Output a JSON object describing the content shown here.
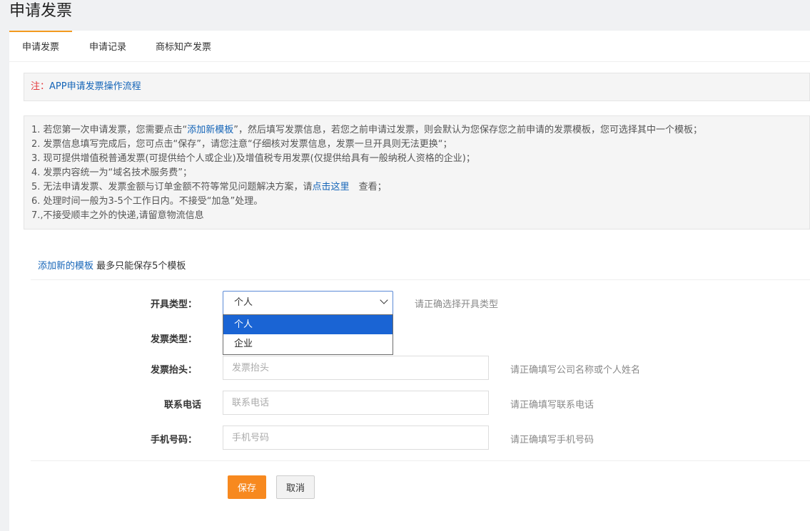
{
  "page": {
    "title": "申请发票"
  },
  "tabs": [
    {
      "label": "申请发票",
      "active": true
    },
    {
      "label": "申请记录",
      "active": false
    },
    {
      "label": "商标知产发票",
      "active": false
    }
  ],
  "note": {
    "prefix": "注：",
    "link_text": "APP申请发票操作流程"
  },
  "info": {
    "line1_pre": "1. 若您第一次申请发票，您需要点击“",
    "line1_link": "添加新模板",
    "line1_post": "”，然后填写发票信息，若您之前申请过发票，则会默认为您保存您之前申请的发票模板，您可选择其中一个模板；",
    "line2": "2. 发票信息填写完成后，您可点击“保存”，请您注意“仔细核对发票信息，发票一旦开具则无法更换“；",
    "line3": "3. 现可提供增值税普通发票(可提供给个人或企业)及增值税专用发票(仅提供给具有一般纳税人资格的企业)；",
    "line4": "4. 发票内容统一为“域名技术服务费”；",
    "line5_pre": "5. 无法申请发票、发票金额与订单金额不符等常见问题解决方案，请",
    "line5_link": "点击这里",
    "line5_post": "　查看；",
    "line6": "6. 处理时间一般为3-5个工作日内。不接受“加急”处理。",
    "line7": "7.,不接受顺丰之外的快递,请留意物流信息"
  },
  "template": {
    "add_link": "添加新的模板",
    "limit_text": " 最多只能保存5个模板"
  },
  "form": {
    "issue_type": {
      "label": "开具类型：",
      "value": "个人",
      "options": [
        "个人",
        "企业"
      ],
      "hint": "请正确选择开具类型"
    },
    "invoice_type": {
      "label": "发票类型："
    },
    "invoice_header": {
      "label": "发票抬头：",
      "placeholder": "发票抬头",
      "hint": "请正确填写公司名称或个人姓名"
    },
    "contact_phone": {
      "label": "联系电话",
      "placeholder": "联系电话",
      "hint": "请正确填写联系电话"
    },
    "mobile": {
      "label": "手机号码：",
      "placeholder": "手机号码",
      "hint": "请正确填写手机号码"
    }
  },
  "buttons": {
    "save": "保存",
    "cancel": "取消"
  },
  "colors": {
    "accent": "#f7891f",
    "link": "#1565b8",
    "note_prefix": "#e4393c",
    "option_selected": "#1a64d4"
  }
}
